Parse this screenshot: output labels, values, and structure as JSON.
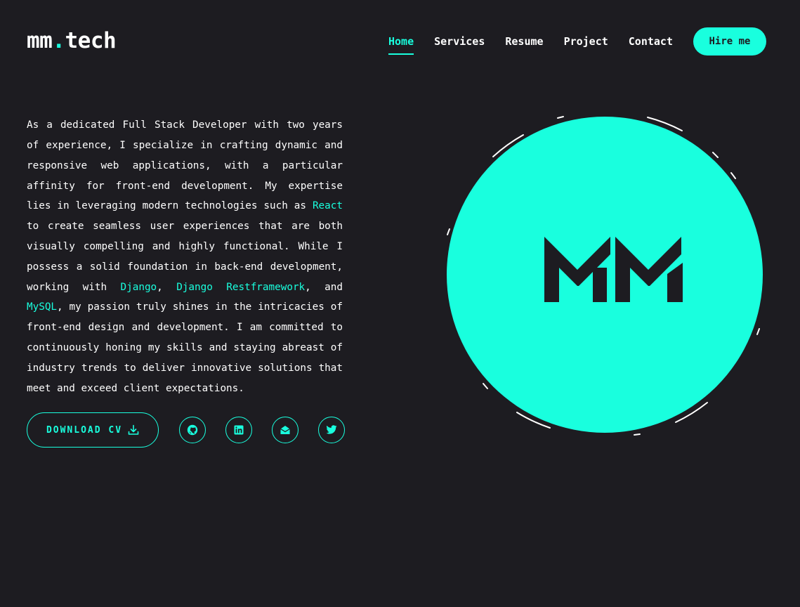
{
  "brand": {
    "name": "mm",
    "dot": ".",
    "suffix": "tech"
  },
  "nav": {
    "items": [
      {
        "label": "Home",
        "active": true
      },
      {
        "label": "Services",
        "active": false
      },
      {
        "label": "Resume",
        "active": false
      },
      {
        "label": "Project",
        "active": false
      },
      {
        "label": "Contact",
        "active": false
      }
    ],
    "cta_label": "Hire me"
  },
  "bio": {
    "part1": "As a dedicated Full Stack Developer with two years of experience, I specialize in crafting dynamic and responsive web applications, with a particular affinity for front-end development. My expertise lies in leveraging modern technologies such as ",
    "tech1": "React",
    "part2": " to create seamless user experiences that are both visually compelling and highly functional. While I possess a solid foundation in back-end development, working with ",
    "tech2": "Django",
    "sep1": ", ",
    "tech3": "Django Restframework",
    "sep2": ", and ",
    "tech4": "MySQL",
    "part3": ", my passion truly shines in the intricacies of front-end design and development. I am committed to continuously honing my skills and staying abreast of industry trends to deliver innovative solutions that meet and exceed client expectations."
  },
  "actions": {
    "download_label": "DOWNLOAD CV",
    "socials": [
      "github-icon",
      "linkedin-icon",
      "email-icon",
      "twitter-icon"
    ]
  },
  "avatar": {
    "monogram": "MM"
  },
  "colors": {
    "accent": "#19ffde",
    "background": "#1d1c21",
    "text": "#ffffff"
  }
}
